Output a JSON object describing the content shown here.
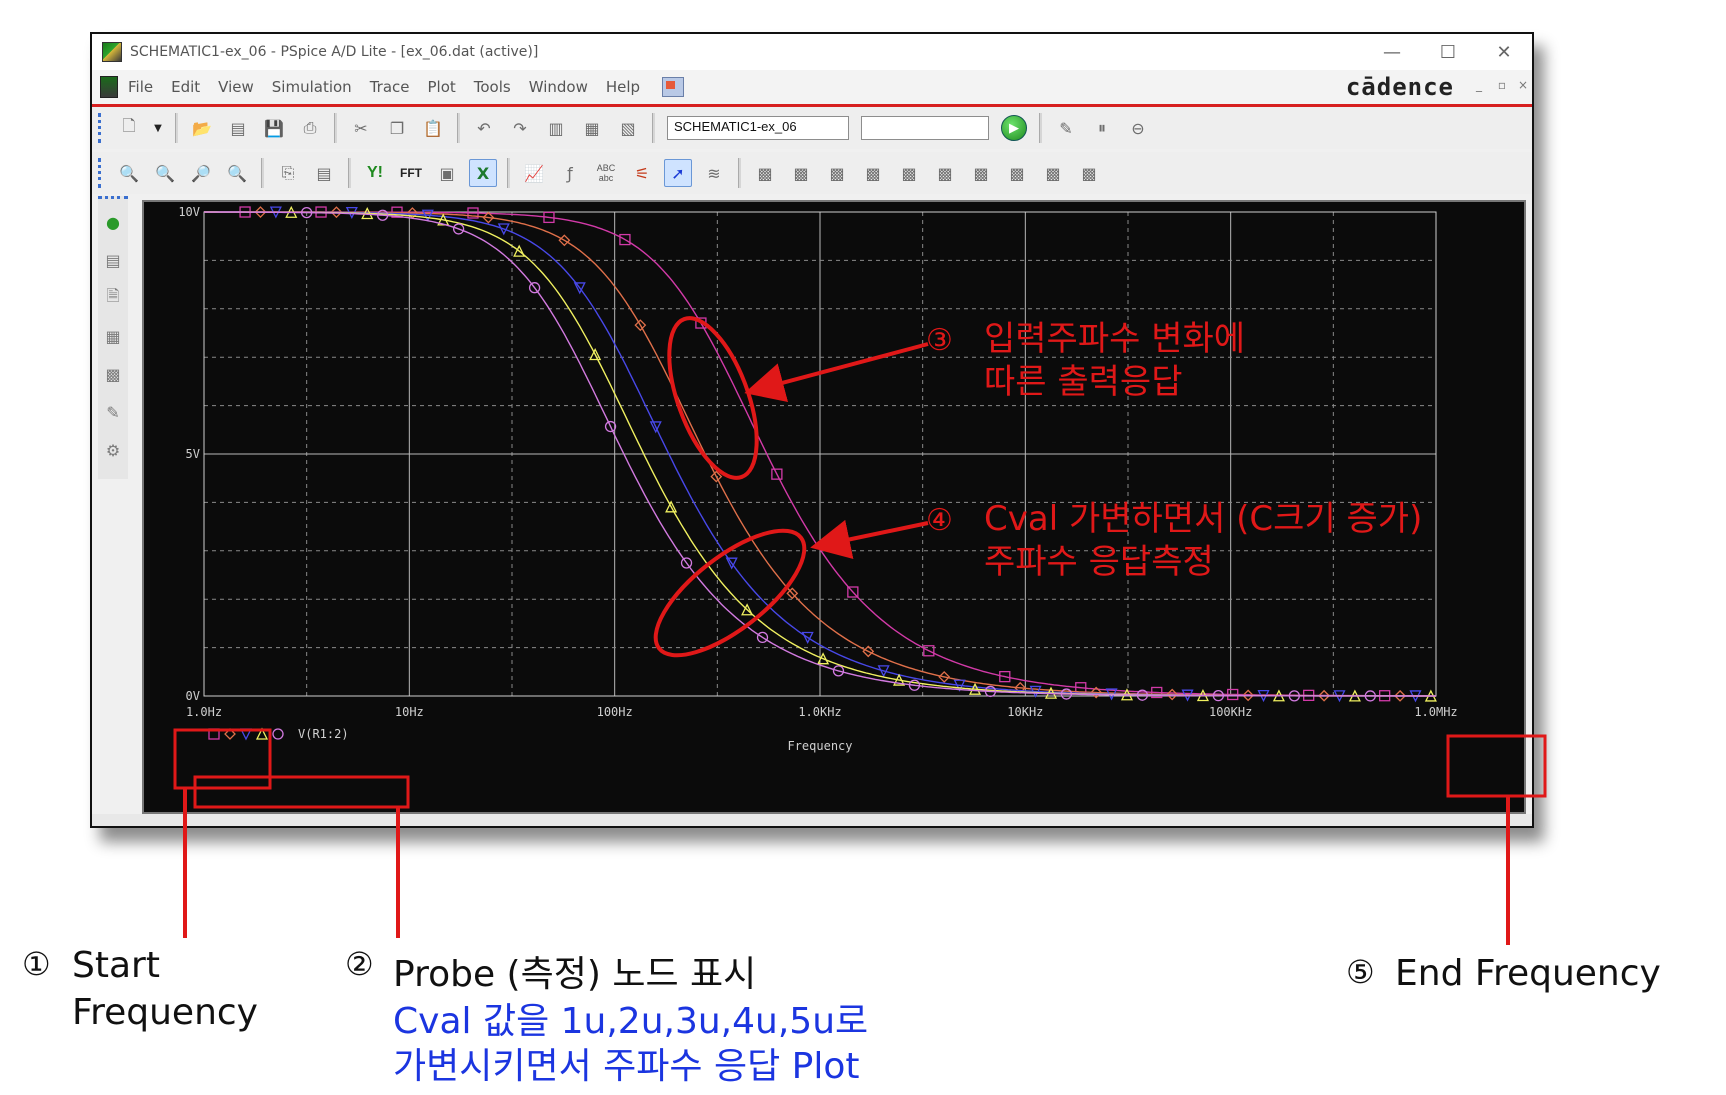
{
  "window": {
    "title": "SCHEMATIC1-ex_06 - PSpice A/D Lite - [ex_06.dat (active)]",
    "controls": {
      "minimize": "—",
      "maximize": "☐",
      "close": "✕"
    }
  },
  "menubar": {
    "items": [
      "File",
      "Edit",
      "View",
      "Simulation",
      "Trace",
      "Plot",
      "Tools",
      "Window",
      "Help"
    ],
    "brand": "cādence"
  },
  "toolbar": {
    "profile_combo": "SCHEMATIC1-ex_06",
    "sim_combo": "",
    "buttons_row1": [
      "new-icon",
      "open-icon",
      "open-sim-icon",
      "save-icon",
      "print-icon",
      "cut-icon",
      "copy-icon",
      "paste-icon",
      "undo-icon",
      "redo-icon",
      "mark-icon",
      "mark-data-icon",
      "mark-all-icon",
      "run-icon",
      "edit-profile-icon",
      "pause-icon",
      "stop-icon"
    ],
    "buttons_row2": [
      "zoom-fit-icon",
      "zoom-in-icon",
      "zoom-out-icon",
      "zoom-area-icon",
      "copy-window-icon",
      "add-y-axis-icon",
      "fft-icon",
      "performance-icon",
      "excel-icon",
      "log-x-icon",
      "eval-icon",
      "text-label-icon",
      "cursor-icon",
      "select-icon",
      "toggle-cursor-icon"
    ],
    "yi_label": "Y!",
    "fft_label": "FFT",
    "abc_label": "ABC abc"
  },
  "chart_data": {
    "type": "line",
    "x_scale": "log",
    "xlabel": "Frequency",
    "xlim": [
      1,
      1000000
    ],
    "ylim": [
      0,
      10
    ],
    "x_ticks": [
      {
        "value": 1,
        "label": "1.0Hz"
      },
      {
        "value": 10,
        "label": "10Hz"
      },
      {
        "value": 100,
        "label": "100Hz"
      },
      {
        "value": 1000,
        "label": "1.0KHz"
      },
      {
        "value": 10000,
        "label": "10KHz"
      },
      {
        "value": 100000,
        "label": "100KHz"
      },
      {
        "value": 1000000,
        "label": "1.0MHz"
      }
    ],
    "y_ticks": [
      {
        "value": 0,
        "label": "0V"
      },
      {
        "value": 5,
        "label": "5V"
      },
      {
        "value": 10,
        "label": "10V"
      }
    ],
    "grid": true,
    "legend": {
      "position": "bottom-left",
      "label": "V(R1:2)",
      "markers": [
        "square",
        "diamond",
        "triangle-down",
        "triangle",
        "circle"
      ]
    },
    "series": [
      {
        "marker": "square",
        "color": "#d23aa8",
        "cutoff_hz": 318
      },
      {
        "marker": "diamond",
        "color": "#e0704a",
        "cutoff_hz": 159
      },
      {
        "marker": "triangle-down",
        "color": "#4848e8",
        "cutoff_hz": 106
      },
      {
        "marker": "triangle",
        "color": "#f0f060",
        "cutoff_hz": 80
      },
      {
        "marker": "circle",
        "color": "#d27ae0",
        "cutoff_hz": 64
      }
    ]
  },
  "annotations": {
    "callout3": {
      "num": "③",
      "line1": "입력주파수  변화에",
      "line2": "따른  출력응답"
    },
    "callout4": {
      "num": "④",
      "line1": "Cval  가변하면서 (C크기  증가)",
      "line2": "주파수  응답측정"
    },
    "label1": {
      "num": "①",
      "line1": "Start",
      "line2": "Frequency"
    },
    "label2": {
      "num": "②",
      "line1": "Probe (측정) 노드 표시",
      "line2": "Cval 값을 1u,2u,3u,4u,5u로",
      "line3": "가변시키면서 주파수 응답 Plot"
    },
    "label5": {
      "num": "⑤",
      "line1": "End Frequency"
    },
    "colors": {
      "red": "#e01818",
      "blue": "#1b35e0"
    }
  }
}
